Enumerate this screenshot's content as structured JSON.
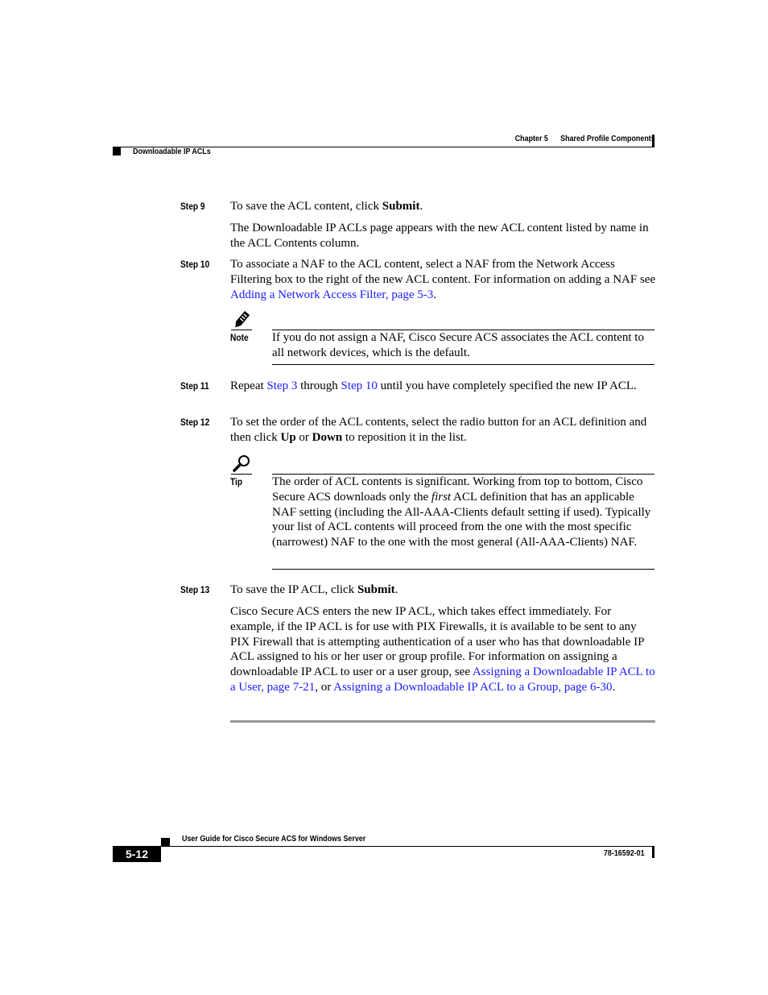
{
  "header": {
    "chapter": "Chapter 5",
    "chapter_title": "Shared Profile Components",
    "section": "Downloadable IP ACLs"
  },
  "steps": {
    "step9": {
      "label": "Step 9",
      "text_before": "To save the ACL content, click ",
      "bold": "Submit",
      "text_after": ".",
      "followup": "The Downloadable IP ACLs page appears with the new ACL content listed by name in the ACL Contents column."
    },
    "step10": {
      "label": "Step 10",
      "text_before": "To associate a NAF to the ACL content, select a NAF from the Network Access Filtering box to the right of the new ACL content. For information on adding a NAF see ",
      "link": "Adding a Network Access Filter, page 5-3",
      "text_after": "."
    },
    "note": {
      "label": "Note",
      "icon": "pencil-icon",
      "text": "If you do not assign a NAF, Cisco Secure ACS associates the ACL content to all network devices, which is the default."
    },
    "step11": {
      "label": "Step 11",
      "t1": "Repeat ",
      "link1": "Step 3",
      "t2": " through ",
      "link2": "Step 10",
      "t3": " until you have completely specified the new IP ACL."
    },
    "step12": {
      "label": "Step 12",
      "t1": "To set the order of the ACL contents, select the radio button for an ACL definition and then click ",
      "b1": "Up",
      "t2": " or ",
      "b2": "Down",
      "t3": " to reposition it in the list."
    },
    "tip": {
      "label": "Tip",
      "icon": "magnifier-icon",
      "t1": "The order of ACL contents is significant. Working from top to bottom, Cisco Secure ACS downloads only the ",
      "italic": "first",
      "t2": " ACL definition that has an applicable NAF setting (including the All-AAA-Clients default setting if used). Typically your list of ACL contents will proceed from the one with the most specific (narrowest) NAF to the one with the most general (All-AAA-Clients) NAF."
    },
    "step13": {
      "label": "Step 13",
      "text_before": "To save the IP ACL, click ",
      "bold": "Submit",
      "text_after": ".",
      "f1": "Cisco Secure ACS enters the new IP ACL, which takes effect immediately. For example, if the IP ACL is for use with PIX Firewalls, it is available to be sent to any PIX Firewall that is attempting authentication of a user who has that downloadable IP ACL assigned to his or her user or group profile. For information on assigning a downloadable IP ACL to user or a user group, see ",
      "link1": "Assigning a Downloadable IP ACL to a User, page 7-21",
      "f2": ", or ",
      "link2": "Assigning a Downloadable IP ACL to a Group, page 6-30",
      "f3": "."
    }
  },
  "footer": {
    "guide_title": "User Guide for Cisco Secure ACS for Windows Server",
    "page_number": "5-12",
    "doc_number": "78-16592-01"
  },
  "colors": {
    "link": "#1a1aff",
    "end_rule": "#999999"
  }
}
